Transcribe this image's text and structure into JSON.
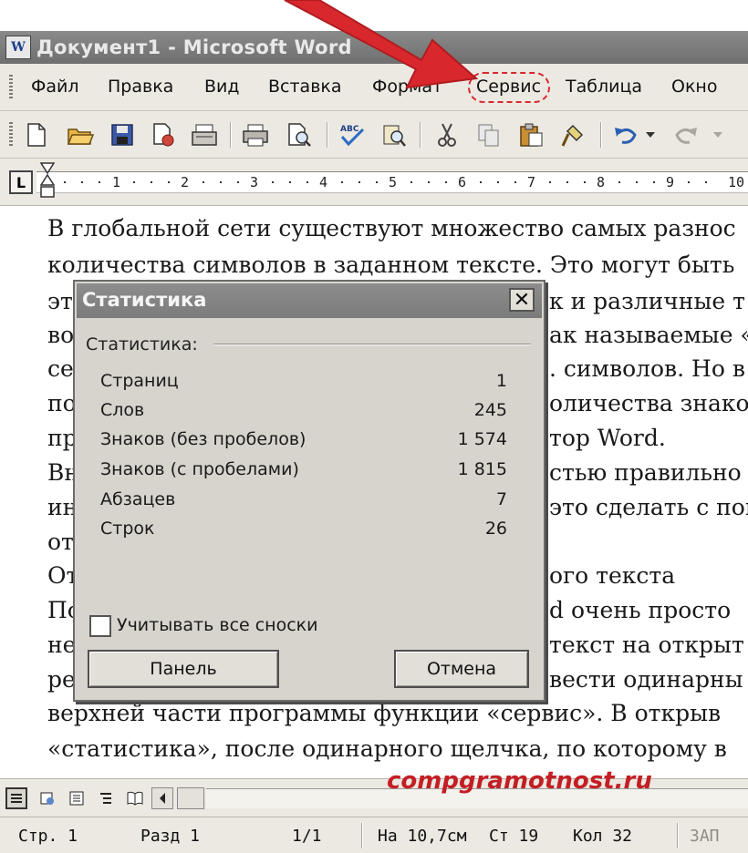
{
  "window": {
    "title": "Документ1 - Microsoft Word",
    "app_icon": "word-document-icon"
  },
  "menubar": {
    "items": [
      "Файл",
      "Правка",
      "Вид",
      "Вставка",
      "Формат",
      "Сервис",
      "Таблица",
      "Окно"
    ],
    "highlighted": "Сервис",
    "highlight_color": "#d8282d"
  },
  "toolbar": {
    "icons": [
      "new-document-icon",
      "open-folder-icon",
      "save-icon",
      "permission-icon",
      "email-icon",
      "print-icon",
      "print-preview-icon",
      "spelling-icon",
      "research-icon",
      "cut-icon",
      "copy-icon",
      "paste-icon",
      "format-painter-icon",
      "undo-icon",
      "redo-icon"
    ]
  },
  "ruler": {
    "tab_label": "L",
    "numbers": [
      "1",
      "2",
      "3",
      "4",
      "5",
      "6",
      "7",
      "8",
      "9",
      "10"
    ]
  },
  "document": {
    "lines": [
      "В глобальной сети существуют множество самых разнос",
      "количества символов в заданном тексте. Это могут быть",
      "эт",
      "во",
      "се",
      "по",
      "пр",
      "Вн",
      "ин",
      "от",
      "От",
      "По",
      "не",
      "ре",
      "верхней части программы функции «сервис». В открыв",
      "«статистика», после одинарного щелчка, по которому в"
    ],
    "right_fragments": [
      "к и различные т",
      "ак называемые «",
      ". символов. Но в",
      "оличества знако",
      "тор Word.",
      "стью правильно",
      "это сделать с пом",
      "ого текста",
      "d  очень просто",
      "текст на открыт",
      "вести одинарны"
    ]
  },
  "dialog": {
    "title": "Статистика",
    "group_label": "Статистика:",
    "stats": [
      {
        "label": "Страниц",
        "value": "1"
      },
      {
        "label": "Слов",
        "value": "245"
      },
      {
        "label": "Знаков (без пробелов)",
        "value": "1 574"
      },
      {
        "label": "Знаков (с пробелами)",
        "value": "1 815"
      },
      {
        "label": "Абзацев",
        "value": "7"
      },
      {
        "label": "Строк",
        "value": "26"
      }
    ],
    "checkbox_label": "Учитывать все сноски",
    "checkbox_checked": false,
    "panel_button": "Панель",
    "cancel_button": "Отмена"
  },
  "statusbar": {
    "page": "Стр. 1",
    "section": "Разд 1",
    "page_of": "1/1",
    "position": "На 10,7см",
    "line": "Ст 19",
    "column": "Кол 32",
    "rec": "ЗАП"
  },
  "watermark": "compgramotnost.ru"
}
